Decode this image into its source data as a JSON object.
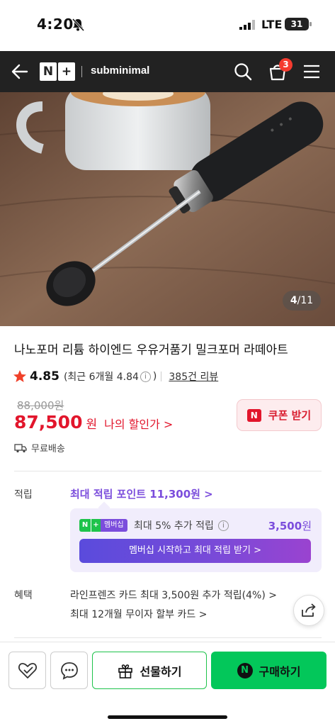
{
  "status": {
    "time": "4:20",
    "network": "LTE",
    "battery": "31"
  },
  "header": {
    "brand_logo": "N+",
    "brand_name": "subminimal",
    "cart_count": "3"
  },
  "gallery": {
    "current": "4",
    "total": "/11"
  },
  "product": {
    "title": "나노포머 리튬 하이엔드 우유거품기 밀크포머 라떼아트",
    "rating": "4.85",
    "rating_recent": "(최근 6개월 4.84",
    "rating_recent_close": ")",
    "review_count": "385건 리뷰",
    "original_price": "88,000원",
    "price": "87,500",
    "price_unit": "원",
    "my_discount": "나의 할인가 >",
    "coupon_label": "쿠폰 받기",
    "shipping": "무료배송"
  },
  "points": {
    "label": "적립",
    "title": "최대 적립 포인트 11,300원 >",
    "member_badge": "멤버십",
    "member_text": "최대 5% 추가 적립",
    "member_amount": "3,500",
    "member_amount_unit": "원",
    "member_cta": "멤버십 시작하고 최대 적립 받기 >"
  },
  "benefits": {
    "label": "혜택",
    "line1": "라인프렌즈 카드 최대 3,500원 추가 적립(4%) >",
    "line2": "최대 12개월 무이자 할부 카드 >"
  },
  "bottom": {
    "gift_label": "선물하기",
    "buy_label": "구매하기"
  },
  "colors": {
    "naver_green": "#03c75a",
    "price_red": "#e2162c",
    "membership_purple": "#7b4ddc"
  },
  "icons": [
    "back-arrow-icon",
    "search-icon",
    "cart-icon",
    "menu-icon",
    "star-icon",
    "info-icon",
    "truck-icon",
    "share-icon",
    "heart-check-icon",
    "chat-bubble-icon",
    "gift-icon"
  ]
}
